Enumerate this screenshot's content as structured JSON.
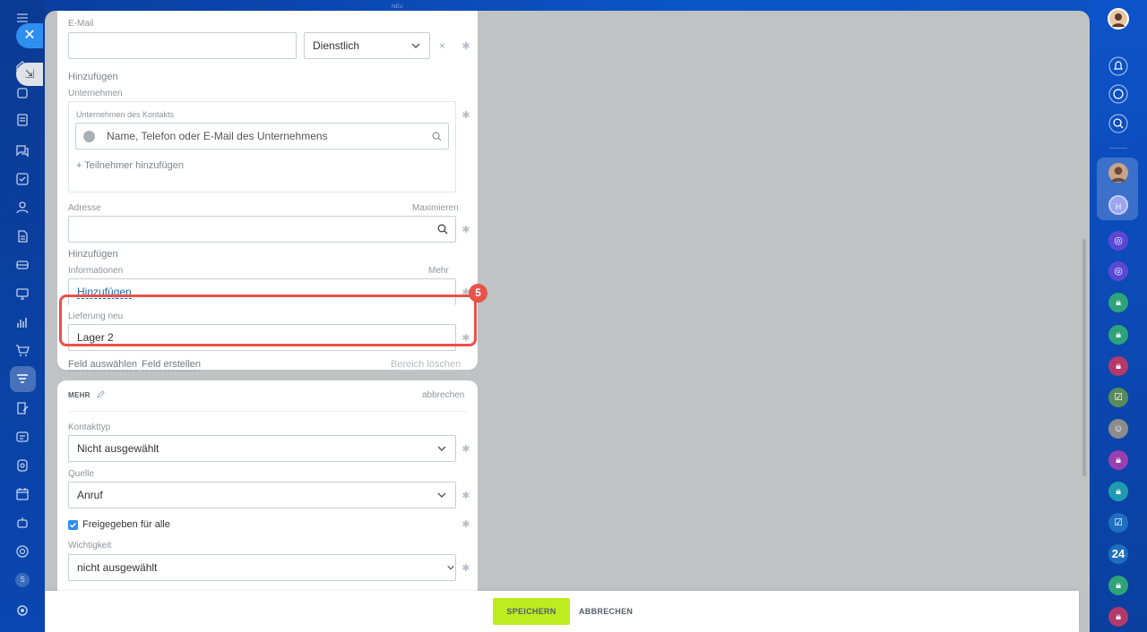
{
  "top_hint": "NEU",
  "email": {
    "label": "E-Mail",
    "type_value": "Dienstlich",
    "add_label": "Hinzufügen"
  },
  "company": {
    "section_label": "Unternehmen",
    "box_label": "Unternehmen des Kontakts",
    "search_placeholder": "Name, Telefon oder E-Mail des Unternehmens",
    "add_participant": "+ Teilnehmer hinzufügen"
  },
  "address": {
    "label": "Adresse",
    "maximize": "Maximieren",
    "add_label": "Hinzufügen"
  },
  "info": {
    "label": "Informationen",
    "more": "Mehr",
    "link": "Hinzufügen"
  },
  "delivery": {
    "label": "Lieferung neu",
    "value": "Lager 2",
    "step": "5"
  },
  "section_links": {
    "select_field": "Feld auswählen",
    "create_field": "Feld erstellen",
    "delete_section": "Bereich löschen"
  },
  "more_section": {
    "title": "MEHR",
    "cancel": "abbrechen",
    "contact_type_label": "Kontakttyp",
    "contact_type_value": "Nicht ausgewählt",
    "source_label": "Quelle",
    "source_value": "Anruf",
    "shared_label": "Freigegeben für alle",
    "importance_label": "Wichtigkeit",
    "importance_value": "nicht ausgewählt"
  },
  "footer": {
    "save": "SPEICHERN",
    "cancel": "ABBRECHEN"
  },
  "right_bar": {
    "counter": "24",
    "avatar_initial": "H"
  },
  "left_bar": {
    "user_letter": "S"
  },
  "colors": {
    "accent_blue": "#2f8ff0",
    "save_green": "#bbed21",
    "highlight_red": "#e8524b",
    "link_blue": "#2067b0"
  }
}
